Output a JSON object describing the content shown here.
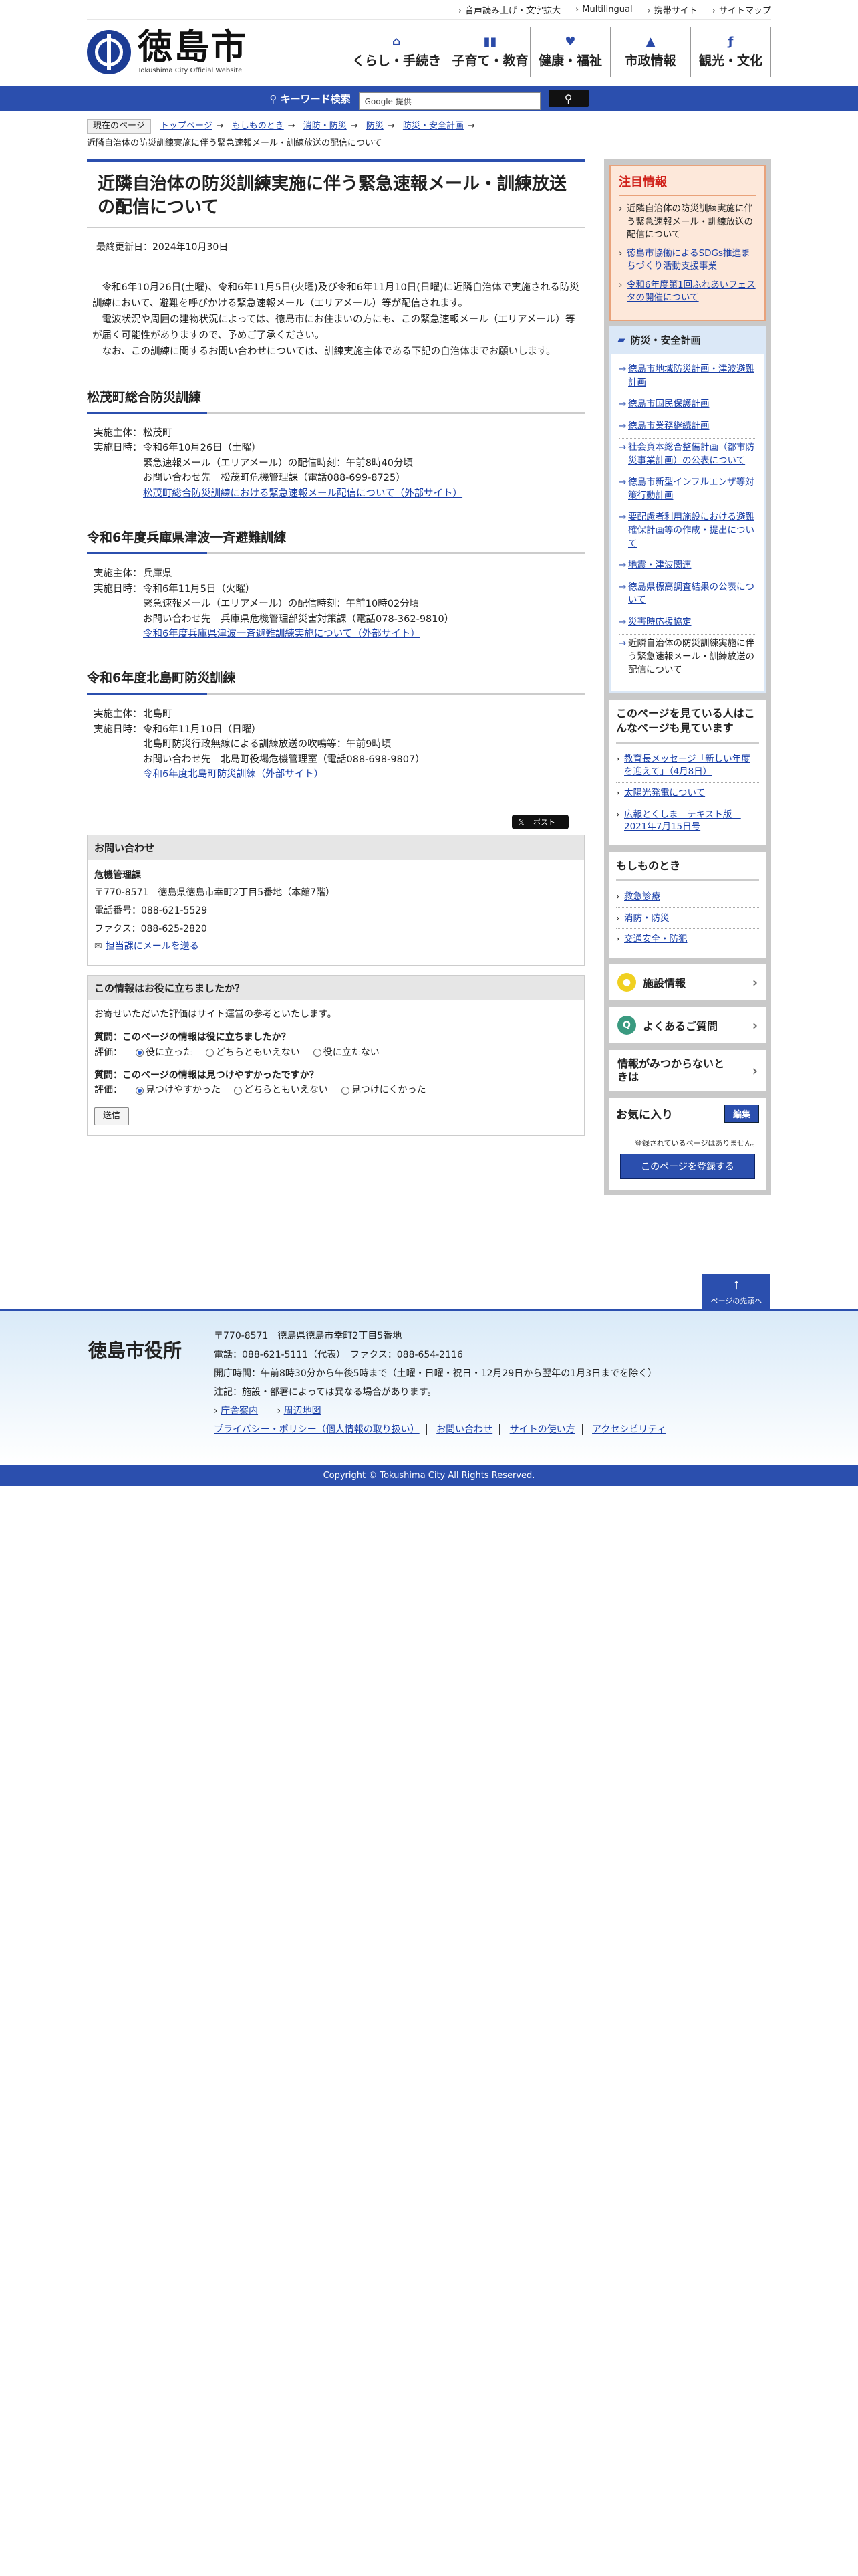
{
  "top_links": [
    "音声読み上げ・文字拡大",
    "Multilingual",
    "携帯サイト",
    "サイトマップ"
  ],
  "logo": {
    "jp": "徳島市",
    "en": "Tokushima City Official Website"
  },
  "gnav": [
    {
      "label": "くらし・手続き",
      "icon": "house-icon",
      "glyph": "⌂"
    },
    {
      "label": "子育て・教育",
      "icon": "book-icon",
      "glyph": "▮▮"
    },
    {
      "label": "健康・福祉",
      "icon": "heart-icon",
      "glyph": "♥"
    },
    {
      "label": "市政情報",
      "icon": "building-icon",
      "glyph": "▲"
    },
    {
      "label": "観光・文化",
      "icon": "tourism-icon",
      "glyph": "ƒ"
    }
  ],
  "search": {
    "label": "キーワード検索",
    "placeholder": "Google 提供",
    "button_icon": "search-icon"
  },
  "breadcrumb": {
    "here": "現在のページ",
    "items": [
      "トップページ",
      "もしものとき",
      "消防・防災",
      "防災",
      "防災・安全計画"
    ],
    "current": "近隣自治体の防災訓練実施に伴う緊急速報メール・訓練放送の配信について"
  },
  "page": {
    "title": "近隣自治体の防災訓練実施に伴う緊急速報メール・訓練放送の配信について",
    "updated": "最終更新日：2024年10月30日",
    "lead": [
      "令和6年10月26日(土曜)、令和6年11月5日(火曜)及び令和6年11月10日(日曜)に近隣自治体で実施される防災訓練において、避難を呼びかける緊急速報メール（エリアメール）等が配信されます。",
      "電波状況や周囲の建物状況によっては、徳島市にお住まいの方にも、この緊急速報メール（エリアメール）等が届く可能性がありますので、予めご了承ください。",
      "なお、この訓練に関するお問い合わせについては、訓練実施主体である下記の自治体までお願いします。"
    ]
  },
  "sections": [
    {
      "heading": "松茂町総合防災訓練",
      "host_k": "実施主体：",
      "host": "松茂町",
      "date_k": "実施日時：",
      "date": "令和6年10月26日（土曜）",
      "lines": [
        "緊急速報メール（エリアメール）の配信時刻：午前8時40分頃",
        "お問い合わせ先　松茂町危機管理課（電話088-699-8725）"
      ],
      "link": "松茂町総合防災訓練における緊急速報メール配信について（外部サイト）"
    },
    {
      "heading": "令和6年度兵庫県津波一斉避難訓練",
      "host_k": "実施主体：",
      "host": "兵庫県",
      "date_k": "実施日時：",
      "date": "令和6年11月5日（火曜）",
      "lines": [
        "緊急速報メール（エリアメール）の配信時刻：午前10時02分頃",
        "お問い合わせ先　兵庫県危機管理部災害対策課（電話078-362-9810）"
      ],
      "link": "令和6年度兵庫県津波一斉避難訓練実施について（外部サイト）"
    },
    {
      "heading": "令和6年度北島町防災訓練",
      "host_k": "実施主体：",
      "host": "北島町",
      "date_k": "実施日時：",
      "date": "令和6年11月10日（日曜）",
      "lines": [
        "北島町防災行政無線による訓練放送の吹鳴等：午前9時頃",
        "お問い合わせ先　北島町役場危機管理室（電話088-698-9807）"
      ],
      "link": "令和6年度北島町防災訓練（外部サイト）"
    }
  ],
  "tweet": "ポスト",
  "contact": {
    "title": "お問い合わせ",
    "dept": "危機管理課",
    "address": "〒770-8571　徳島県徳島市幸町2丁目5番地（本館7階）",
    "tel": "電話番号：088-621-5529",
    "fax": "ファクス：088-625-2820",
    "mail": "担当課にメールを送る"
  },
  "survey": {
    "title": "この情報はお役に立ちましたか？",
    "intro": "お寄せいただいた評価はサイト運営の参考といたします。",
    "q1": "質問：このページの情報は役に立ちましたか？",
    "q1_opts": [
      "役に立った",
      "どちらともいえない",
      "役に立たない"
    ],
    "q2": "質問：このページの情報は見つけやすかったですか？",
    "q2_opts": [
      "見つけやすかった",
      "どちらともいえない",
      "見つけにくかった"
    ],
    "eval": "評価：",
    "submit": "送信"
  },
  "notice": {
    "title": "注目情報",
    "items": [
      {
        "text": "近隣自治体の防災訓練実施に伴う緊急速報メール・訓練放送の配信について",
        "link": false
      },
      {
        "text": "徳島市協働によるSDGs推進まちづくり活動支援事業",
        "link": true
      },
      {
        "text": "令和6年度第1回ふれあいフェスタの開催について",
        "link": true
      }
    ]
  },
  "category": {
    "title": "防災・安全計画",
    "items": [
      {
        "text": "徳島市地域防災計画・津波避難計画",
        "link": true
      },
      {
        "text": "徳島市国民保護計画",
        "link": true
      },
      {
        "text": "徳島市業務継続計画",
        "link": true
      },
      {
        "text": "社会資本総合整備計画（都市防災事業計画）の公表について",
        "link": true
      },
      {
        "text": "徳島市新型インフルエンザ等対策行動計画",
        "link": true
      },
      {
        "text": "要配慮者利用施設における避難確保計画等の作成・提出について",
        "link": true
      },
      {
        "text": "地震・津波関連",
        "link": true
      },
      {
        "text": "徳島県標高調査結果の公表について",
        "link": true
      },
      {
        "text": "災害時応援協定",
        "link": true
      },
      {
        "text": "近隣自治体の防災訓練実施に伴う緊急速報メール・訓練放送の配信について",
        "link": false
      }
    ]
  },
  "also_viewed": {
    "title": "このページを見ている人はこんなページも見ています",
    "items": [
      "教育長メッセージ「新しい年度を迎えて」（4月8日）",
      "太陽光発電について",
      "広報とくしま　テキスト版　2021年7月15日号"
    ]
  },
  "emergency": {
    "title": "もしものとき",
    "items": [
      "救急診療",
      "消防・防災",
      "交通安全・防犯"
    ]
  },
  "side_buttons": [
    {
      "label": "施設情報",
      "icon": "facility-icon",
      "glyph": "●",
      "bg": "#f0d020"
    },
    {
      "label": "よくあるご質問",
      "icon": "faq-icon",
      "glyph": "Q",
      "bg": "#3a9a80"
    },
    {
      "label": "情報がみつからないときは",
      "icon": "",
      "glyph": "",
      "bg": ""
    }
  ],
  "favorites": {
    "title": "お気に入り",
    "edit": "編集",
    "none": "登録されているページはありません。",
    "register": "このページを登録する"
  },
  "totop": "ページの先頭へ",
  "footer": {
    "name": "徳島市役所",
    "address": "〒770-8571　徳島県徳島市幸町2丁目5番地",
    "tel": "電話：088-621-5111（代表）　ファクス：088-654-2116",
    "hours": "開庁時間：午前8時30分から午後5時まで（土曜・日曜・祝日・12月29日から翌年の1月3日までを除く）",
    "note": "注記：施設・部署によっては異なる場合があります。",
    "links1": [
      "庁舎案内",
      "周辺地図"
    ],
    "links2": [
      "プライバシー・ポリシー（個人情報の取り扱い）",
      "お問い合わせ",
      "サイトの使い方",
      "アクセシビリティ"
    ]
  },
  "copyright": "Copyright © Tokushima City All Rights Reserved.",
  "colors": {
    "brand": "#2b4fae",
    "notice": "#d0221b"
  }
}
